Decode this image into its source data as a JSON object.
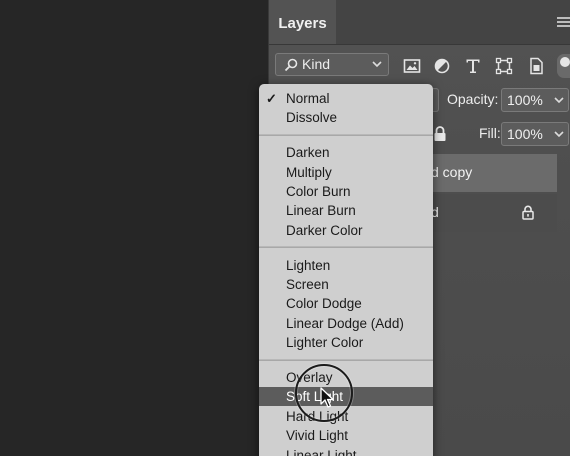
{
  "panel": {
    "tab_label": "Layers",
    "kind_filter": {
      "label": "Kind"
    },
    "filter_icons": [
      "image-filter-icon",
      "adjustment-filter-icon",
      "type-filter-icon",
      "shape-filter-icon",
      "smart-object-filter-icon"
    ],
    "opacity": {
      "label": "Opacity:",
      "value": "100%"
    },
    "fill": {
      "label": "Fill:",
      "value": "100%"
    },
    "layers": [
      {
        "name": "d copy",
        "selected": true,
        "locked": false
      },
      {
        "name": "d",
        "selected": false,
        "locked": true
      }
    ]
  },
  "blend_menu": {
    "groups": [
      {
        "items": [
          "Normal",
          "Dissolve"
        ]
      },
      {
        "items": [
          "Darken",
          "Multiply",
          "Color Burn",
          "Linear Burn",
          "Darker Color"
        ]
      },
      {
        "items": [
          "Lighten",
          "Screen",
          "Color Dodge",
          "Linear Dodge (Add)",
          "Lighter Color"
        ]
      },
      {
        "items": [
          "Overlay",
          "Soft Light",
          "Hard Light",
          "Vivid Light",
          "Linear Light"
        ]
      }
    ],
    "checked_item": "Normal",
    "highlighted_item": "Soft Light"
  },
  "colors": {
    "workspace_bg": "#262626",
    "panel_bg": "#535353",
    "menu_bg": "#cfcfcf",
    "menu_highlight": "#5c5c5c"
  }
}
